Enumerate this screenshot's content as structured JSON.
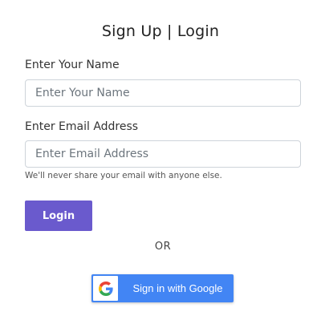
{
  "form": {
    "title": "Sign Up | Login",
    "name_label": "Enter Your Name",
    "name_placeholder": "Enter Your Name",
    "name_value": "",
    "email_label": "Enter Email Address",
    "email_placeholder": "Enter Email Address",
    "email_value": "",
    "email_help": "We'll never share your email with anyone else.",
    "login_label": "Login",
    "separator": "OR"
  },
  "google": {
    "label": "Sign in with Google",
    "icon": "google-g-icon"
  },
  "colors": {
    "login_button": "#6a5acd",
    "google_button": "#4285f4",
    "input_border": "#ced4da",
    "google_blue": "#4285F4",
    "google_red": "#EA4335",
    "google_yellow": "#FBBC05",
    "google_green": "#34A853"
  }
}
